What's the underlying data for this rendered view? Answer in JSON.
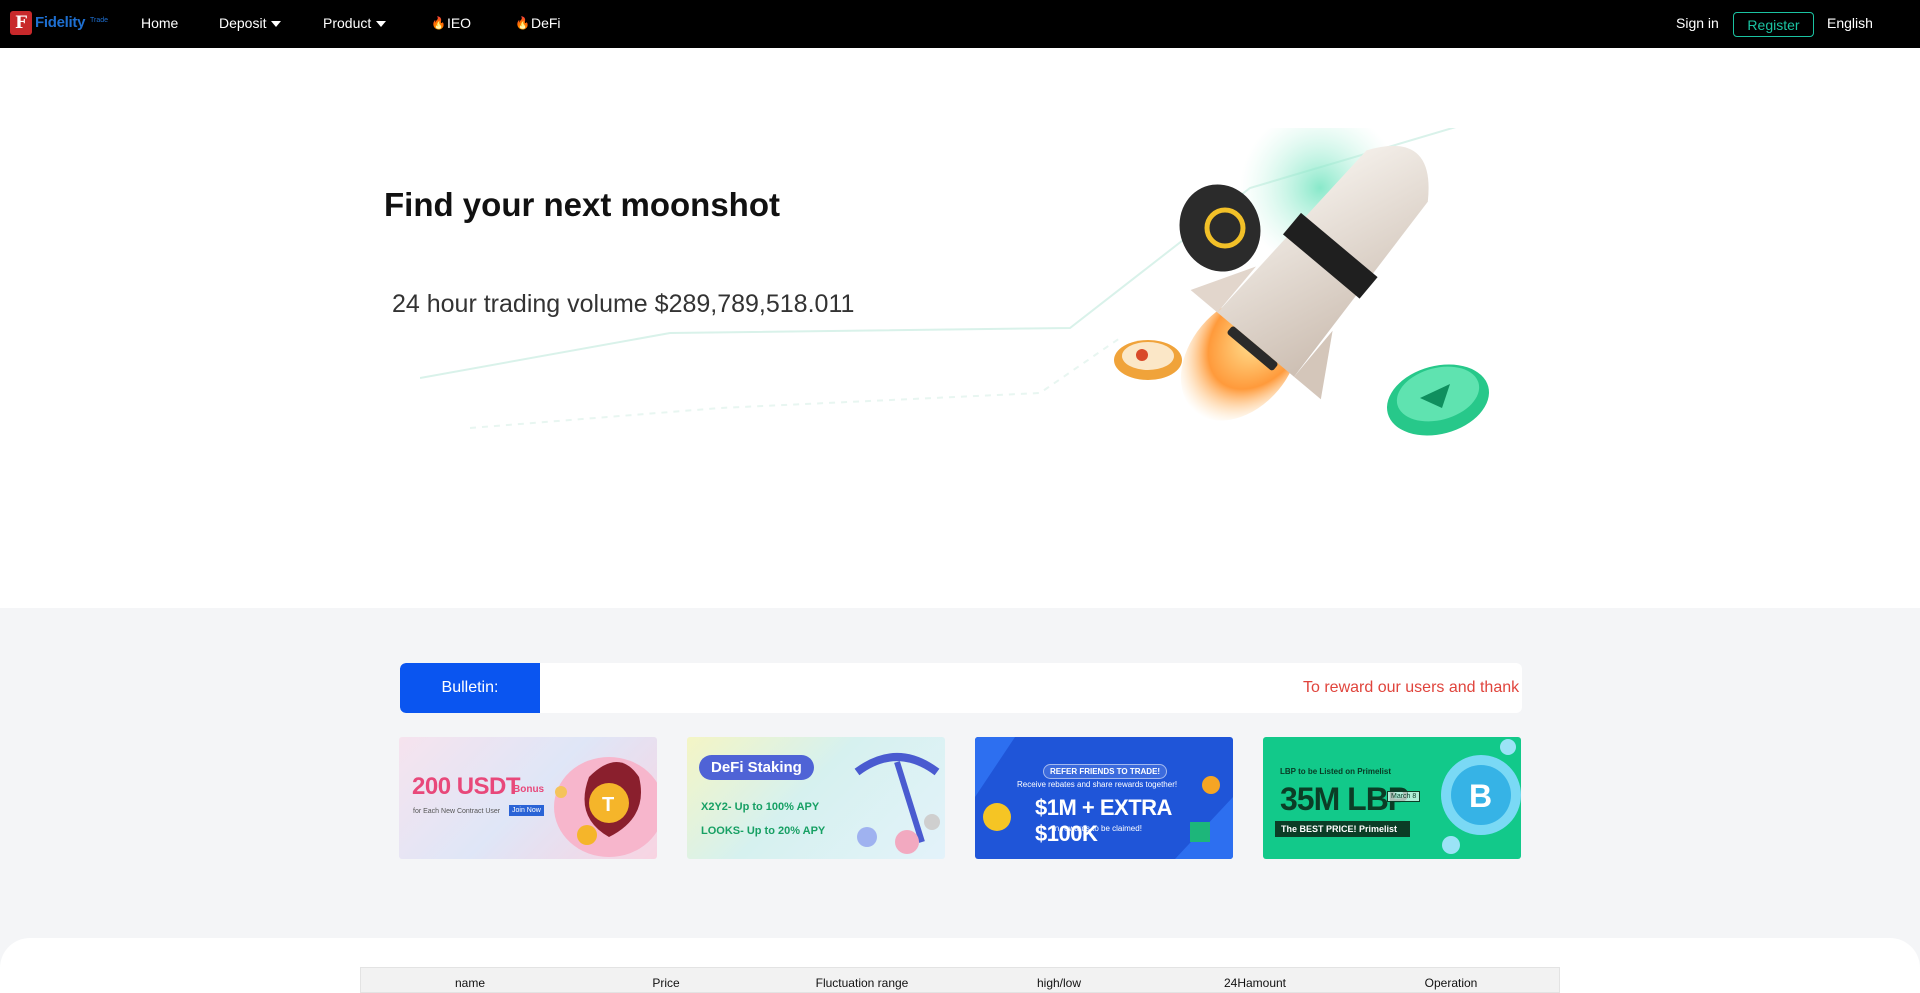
{
  "nav": {
    "logo_letter": "F",
    "logo_text": "Fidelity",
    "logo_sub": "Trade",
    "items": [
      {
        "label": "Home"
      },
      {
        "label": "Deposit"
      },
      {
        "label": "Product"
      },
      {
        "label": "IEO"
      },
      {
        "label": "DeFi"
      }
    ],
    "sign_in": "Sign in",
    "register": "Register",
    "language": "English"
  },
  "hero": {
    "title": "Find your next moonshot",
    "volume": "24 hour trading volume $289,789,518.011"
  },
  "bulletin": {
    "label": "Bulletin:",
    "text": "To reward our users and thank"
  },
  "banners": {
    "b1": {
      "main": "200 USDT",
      "bonus": "Bonus",
      "sub": "for Each New Contract User",
      "cta": "Join Now"
    },
    "b2": {
      "title": "DeFi Staking",
      "line1": "X2Y2- Up to 100% APY",
      "line2": "LOOKS- Up to 20% APY"
    },
    "b3": {
      "head": "REFER FRIENDS TO TRADE!",
      "sub": "Receive rebates and share rewards together!",
      "main": "$1M + EXTRA $100K",
      "foot": "in rewards to be claimed!"
    },
    "b4": {
      "top": "LBP to be Listed on Primelist",
      "main": "35M LBP",
      "date": "March 8",
      "bar": "The BEST PRICE!  Primelist"
    }
  },
  "market": {
    "columns": [
      "name",
      "Price",
      "Fluctuation range",
      "high/low",
      "24Hamount",
      "Operation"
    ]
  },
  "colors": {
    "nav_bg": "#000000",
    "accent": "#1bc3a2",
    "bulletin_label": "#0a55f0",
    "bulletin_text": "#e0443c"
  }
}
